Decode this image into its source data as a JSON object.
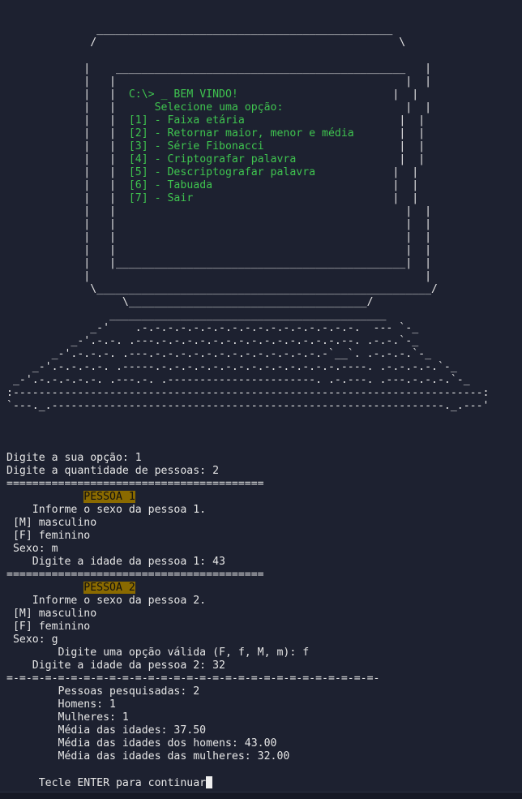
{
  "ascii_art": {
    "monitor_top": [
      "              ______________________________________________",
      "             /                                               \\",
      "                                                                 ",
      "            |    _____________________________________________   |",
      "            |   |                                             |  |"
    ],
    "menu": [
      "C:\\> _ BEM VINDO!",
      "    Selecione uma opção:",
      "[1] - Faixa etária",
      "[2] - Retornar maior, menor e média",
      "[3] - Série Fibonacci",
      "[4] - Criptografar palavra",
      "[5] - Descriptografar palavra",
      "[6] - Tabuada",
      "[7] - Sair"
    ],
    "menu_prefix": "            |   |  ",
    "menu_suffixes": [
      "                        |  |",
      "                   |  |",
      "                        |  |",
      "       |  |",
      "                     |  |",
      "                |  |",
      "            |  |",
      "                            |  |",
      "                               |  |"
    ],
    "monitor_bottom": [
      "            |   |                                             |  |",
      "            |   |                                             |  |",
      "            |   |                                             |  |",
      "            |   |                                             |  |",
      "            |   |_____________________________________________|  |",
      "            |                                                    |",
      "             \\____________________________________________________/",
      "                  \\_____________________________________/",
      "                ___________________________________________",
      "             _-'    .-.-.-.-.-.-.-.-.-.-.-.-.-.-.-.-.-.  --- `-_",
      "          _-'.-.-. .---.-.-.-.-.-.-.-.-.-.-.-.-.-.-.--. .-.-.`-_",
      "       _-'.-.-.-. .---.-.-.-.-.-.-.-.-.-.-.-.-.-.-`__`. .-.-.-.`-_",
      "    _-'.-.-.-.-. .-----.-.-.-.-.-.-.-.-.-.-.-.-.-.-.----. .-.-.-.-.`-_",
      " _-'.-.-.-.-.-. .---.-. .-----------------------. .-.---. .---.-.-.-.`-_",
      ":-------------------------------------------------------------------------:",
      "`---._.-------------------------------------------------------------._.---'"
    ]
  },
  "session": {
    "blank_lines": [
      "",
      "",
      ""
    ],
    "prompt_option": "Digite a sua opção: 1",
    "prompt_quantity": "Digite a quantidade de pessoas: 2",
    "separator": "========================================",
    "persons": [
      {
        "title": "PESSOA 1",
        "title_indent": "            ",
        "ask_sex": "    Informe o sexo da pessoa 1.",
        "opt_m": " [M] masculino",
        "opt_f": " [F] feminino",
        "sex_input": " Sexo: m",
        "age_input": "    Digite a idade da pessoa 1: 43"
      },
      {
        "title": "PESSOA 2",
        "title_indent": "            ",
        "ask_sex": "    Informe o sexo da pessoa 2.",
        "opt_m": " [M] masculino",
        "opt_f": " [F] feminino",
        "sex_input": " Sexo: g",
        "invalid_msg": "        Digite uma opção válida (F, f, M, m): f",
        "age_input": "    Digite a idade da pessoa 2: 32"
      }
    ],
    "summary_separator": "=-=-=-=-=-=-=-=-=-=-=-=-=-=-=-=-=-=-=-=-=-=-=-=-=-=-=-=-=-",
    "summary": [
      "        Pessoas pesquisadas: 2",
      "        Homens: 1",
      "        Mulheres: 1",
      "        Média das idades: 37.50",
      "        Média das idades dos homens: 43.00",
      "        Média das idades das mulheres: 32.00"
    ],
    "continue_prompt": "     Tecle ENTER para continuar"
  },
  "colors": {
    "background": "#1d2130",
    "text": "#e6e6e6",
    "menu_green": "#3fc44f",
    "highlight": "#8a6a00"
  }
}
